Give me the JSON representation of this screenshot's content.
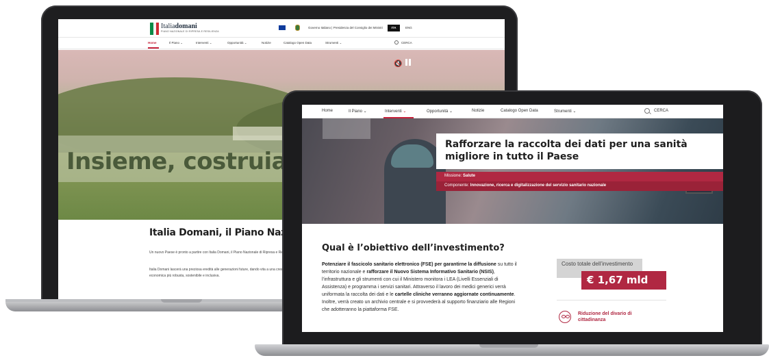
{
  "back_site": {
    "logo": {
      "name_light": "Italia",
      "name_bold": "domani",
      "subtitle": "PIANO NAZIONALE DI RIPRESA E RESILIENZA"
    },
    "gov_text": "Governo Italiano  |  Presidenza del Consiglio dei Ministri",
    "lang": {
      "active": "ITA",
      "other": "ENG"
    },
    "nav": [
      "Home",
      "Il Piano",
      "Interventi",
      "Opportunità",
      "Notizie",
      "Catalogo Open Data",
      "Strumenti"
    ],
    "search_label": "CERCA",
    "hero_title": "Insieme, costruiamo",
    "section_title": "Italia Domani, il Piano Nazionale",
    "para1": "Un nuovo Paese è pronto a partire con Italia Domani, il Piano Nazionale di Ripresa e Resilienza.",
    "para2": "Italia Domani lascerà una preziosa eredità alle generazioni future, dando vita a una crescita economica più robusta, sostenibile e inclusiva."
  },
  "front_site": {
    "nav": [
      "Home",
      "Il Piano",
      "Interventi",
      "Opportunità",
      "Notizie",
      "Catalogo Open Data",
      "Strumenti"
    ],
    "active_nav": "Interventi",
    "search_label": "CERCA",
    "hero_title": "Rafforzare la raccolta dei dati per una sanità migliore in tutto il Paese",
    "mission_label": "Missione: ",
    "mission_value": "Salute",
    "component_label": "Componente: ",
    "component_value": "Innovazione, ricerca e digitalizzazione del servizio sanitario nazionale",
    "question": "Qual è l’obiettivo dell’investimento?",
    "body": [
      {
        "text": "Potenziare il fascicolo sanitario elettronico (FSE) per garantirne la diffusione",
        "bold": true
      },
      {
        "text": " su tutto il territorio nazionale e ",
        "bold": false
      },
      {
        "text": "rafforzare il Nuovo Sistema Informativo Sanitario (NSIS)",
        "bold": true
      },
      {
        "text": ", l’infrastruttura e gli strumenti con cui il Ministero monitora i LEA (Livelli Essenziali di Assistenza) e programma i servizi sanitari. Attraverso il lavoro dei medici generici verrà uniformata la raccolta dei dati e le ",
        "bold": false
      },
      {
        "text": "cartelle cliniche verranno aggiornate continuamente",
        "bold": true
      },
      {
        "text": ". Inoltre, verrà creato un archivio centrale e si provvederà al supporto finanziario alle Regioni che adotteranno la piattaforma FSE.",
        "bold": false
      }
    ],
    "cost_label": "Costo totale dell’investimento",
    "cost_value": "€ 1,67 mld",
    "goal": "Riduzione del divario di cittadinanza"
  },
  "colors": {
    "accent": "#c6213a",
    "strip": "#b02842"
  },
  "icons": [
    "chevron-down-icon",
    "search-icon",
    "mute-icon",
    "pause-icon",
    "eu-flag-icon",
    "emblem-icon",
    "citizenship-icon"
  ]
}
